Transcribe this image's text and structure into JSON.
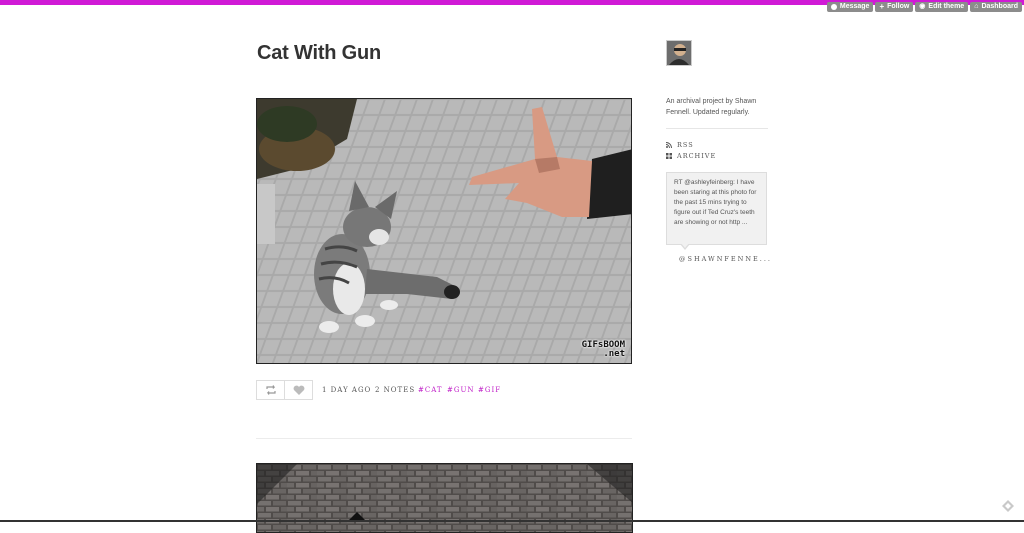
{
  "theme": {
    "accent": "#d01ad6",
    "tag_color": "#c020c8"
  },
  "controls": [
    {
      "label": "Message",
      "icon": "message-icon"
    },
    {
      "label": "Follow",
      "icon": "plus-icon"
    },
    {
      "label": "Edit theme",
      "icon": "eye-icon"
    },
    {
      "label": "Dashboard",
      "icon": "home-icon"
    }
  ],
  "post": {
    "title": "Cat With Gun",
    "watermark_line1": "GIFsBOOM",
    "watermark_line2": ".net",
    "time": "1 DAY AGO",
    "notes": "2 NOTES",
    "tags": [
      "#CAT",
      "#GUN",
      "#GIF"
    ]
  },
  "sidebar": {
    "bio": "An archival project by Shawn Fennell. Updated regularly.",
    "links": [
      {
        "label": "RSS",
        "icon": "rss-icon"
      },
      {
        "label": "ARCHIVE",
        "icon": "grid-icon"
      }
    ],
    "tweet": "RT @ashleyfeinberg: I have been staring at this photo for the past 15 mins trying to figure out if Ted Cruz's teeth are showing or not http ...",
    "handle": "@SHAWNFENNE..."
  }
}
